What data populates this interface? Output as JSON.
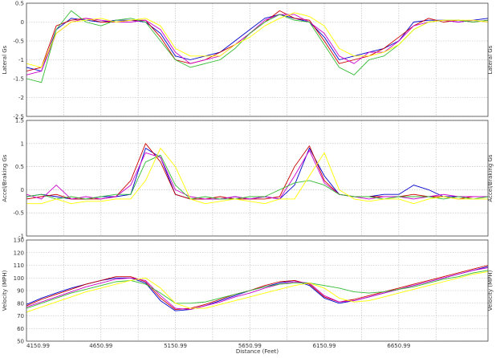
{
  "chart_data": {
    "type": "line",
    "xlabel": "Distance (Feet)",
    "x_ticks": [
      "4150.99",
      "4650.99",
      "5150.99",
      "5650.99",
      "6150.99",
      "6650.99"
    ],
    "xlim": [
      4150.99,
      7250
    ],
    "grid": true,
    "series_colors": [
      "#0000cc",
      "#cc0000",
      "#cc00cc",
      "#33bb33",
      "#ffff00"
    ],
    "x": [
      4150.99,
      4250.99,
      4350.99,
      4450.99,
      4550.99,
      4650.99,
      4750.99,
      4850.99,
      4950.99,
      5050.99,
      5150.99,
      5250.99,
      5350.99,
      5450.99,
      5550.99,
      5650.99,
      5750.99,
      5850.99,
      5950.99,
      6050.99,
      6150.99,
      6250.99,
      6350.99,
      6450.99,
      6550.99,
      6650.99,
      6750.99,
      6850.99,
      6950.99,
      7050.99,
      7150.99,
      7250.99
    ],
    "panels": [
      {
        "ylabel_left": "Lateral Gs",
        "ylabel_right": "Lateral Gs",
        "ylim": [
          -2.5,
          0.5
        ],
        "y_ticks": [
          "0.5",
          "0",
          "-0.5",
          "-1",
          "-1.5",
          "-2",
          "-2.5"
        ],
        "series": [
          {
            "values": [
              -1.2,
              -1.3,
              -0.2,
              0.1,
              0.05,
              0.0,
              0.05,
              0.05,
              0.0,
              -0.3,
              -0.9,
              -1.0,
              -0.9,
              -0.8,
              -0.5,
              -0.2,
              0.1,
              0.2,
              0.1,
              0.0,
              -0.4,
              -1.0,
              -0.9,
              -0.8,
              -0.7,
              -0.5,
              0.0,
              0.05,
              0.05,
              0.0,
              0.05,
              0.1
            ]
          },
          {
            "values": [
              -1.3,
              -1.2,
              -0.1,
              0.05,
              0.1,
              0.0,
              0.0,
              0.05,
              0.05,
              -0.4,
              -1.0,
              -1.1,
              -1.0,
              -0.8,
              -0.6,
              -0.3,
              0.0,
              0.3,
              0.1,
              0.05,
              -0.5,
              -1.1,
              -1.0,
              -0.9,
              -0.7,
              -0.4,
              -0.1,
              0.1,
              0.0,
              0.05,
              0.0,
              0.05
            ]
          },
          {
            "values": [
              -1.4,
              -1.3,
              -0.3,
              0.0,
              0.1,
              0.05,
              0.0,
              0.0,
              0.05,
              -0.2,
              -0.8,
              -1.1,
              -1.0,
              -0.9,
              -0.6,
              -0.3,
              0.05,
              0.2,
              0.2,
              0.0,
              -0.3,
              -0.9,
              -1.1,
              -0.8,
              -0.8,
              -0.5,
              -0.1,
              0.0,
              0.05,
              0.0,
              0.05,
              0.0
            ]
          },
          {
            "values": [
              -1.5,
              -1.6,
              -0.2,
              0.3,
              0.0,
              -0.1,
              0.05,
              0.1,
              0.0,
              -0.5,
              -1.0,
              -1.2,
              -1.1,
              -1.0,
              -0.7,
              -0.3,
              0.0,
              0.2,
              0.05,
              0.0,
              -0.6,
              -1.2,
              -1.4,
              -1.0,
              -0.9,
              -0.6,
              -0.2,
              0.0,
              0.05,
              0.05,
              0.0,
              0.05
            ]
          },
          {
            "values": [
              -1.1,
              -1.2,
              -0.3,
              0.0,
              0.05,
              0.1,
              0.0,
              0.05,
              0.1,
              -0.1,
              -0.7,
              -0.9,
              -0.9,
              -0.9,
              -0.6,
              -0.4,
              -0.1,
              0.1,
              0.25,
              0.15,
              -0.1,
              -0.7,
              -0.9,
              -0.9,
              -0.8,
              -0.6,
              -0.2,
              0.0,
              0.05,
              0.05,
              0.05,
              0.0
            ]
          }
        ]
      },
      {
        "ylabel_left": "Accel/Braking Gs",
        "ylabel_right": "Accel/Braking Gs",
        "ylim": [
          -1,
          1.5
        ],
        "y_ticks": [
          "1.5",
          "1",
          "0.5",
          "0",
          "-0.5",
          "-1"
        ],
        "series": [
          {
            "values": [
              -0.15,
              -0.1,
              -0.15,
              -0.2,
              -0.2,
              -0.15,
              -0.15,
              -0.1,
              0.9,
              0.7,
              -0.1,
              -0.2,
              -0.2,
              -0.2,
              -0.15,
              -0.2,
              -0.15,
              -0.2,
              0.1,
              0.9,
              0.3,
              -0.1,
              -0.15,
              -0.15,
              -0.1,
              -0.1,
              0.1,
              0.0,
              -0.15,
              -0.15,
              -0.15,
              -0.15
            ]
          },
          {
            "values": [
              -0.2,
              -0.15,
              -0.1,
              -0.2,
              -0.2,
              -0.2,
              -0.15,
              0.2,
              1.0,
              0.6,
              -0.1,
              -0.2,
              -0.2,
              -0.15,
              -0.2,
              -0.2,
              -0.2,
              -0.15,
              0.5,
              0.95,
              0.2,
              -0.1,
              -0.15,
              -0.15,
              -0.15,
              -0.15,
              -0.1,
              -0.15,
              -0.15,
              -0.2,
              -0.15,
              -0.15
            ]
          },
          {
            "values": [
              -0.1,
              -0.2,
              0.1,
              -0.2,
              -0.15,
              -0.2,
              -0.15,
              0.1,
              0.8,
              0.7,
              0.0,
              -0.15,
              -0.2,
              -0.2,
              -0.15,
              -0.2,
              -0.15,
              -0.2,
              0.3,
              0.85,
              0.15,
              -0.1,
              -0.15,
              -0.2,
              -0.15,
              -0.15,
              -0.2,
              -0.15,
              -0.1,
              -0.15,
              -0.15,
              -0.15
            ]
          },
          {
            "values": [
              -0.15,
              -0.1,
              -0.2,
              -0.15,
              -0.2,
              -0.15,
              -0.1,
              -0.1,
              0.6,
              0.75,
              0.1,
              -0.2,
              -0.15,
              -0.2,
              -0.2,
              -0.15,
              -0.15,
              0.0,
              0.15,
              0.2,
              0.1,
              -0.1,
              -0.15,
              -0.15,
              -0.2,
              -0.15,
              -0.15,
              -0.15,
              -0.2,
              -0.15,
              -0.2,
              -0.15
            ]
          },
          {
            "values": [
              -0.3,
              -0.3,
              -0.2,
              -0.3,
              -0.25,
              -0.25,
              -0.2,
              -0.2,
              0.2,
              0.9,
              0.5,
              -0.2,
              -0.3,
              -0.25,
              -0.2,
              -0.25,
              -0.3,
              -0.2,
              -0.2,
              0.3,
              0.8,
              0.0,
              -0.2,
              -0.25,
              -0.2,
              -0.2,
              -0.3,
              -0.2,
              -0.15,
              -0.2,
              -0.2,
              -0.2
            ]
          }
        ]
      },
      {
        "ylabel_left": "Velocity (MPH)",
        "ylabel_right": "Velocity (MPH)",
        "ylim": [
          50,
          130
        ],
        "y_ticks": [
          "130",
          "120",
          "110",
          "100",
          "90",
          "80",
          "70",
          "60",
          "50"
        ],
        "series": [
          {
            "values": [
              79,
              84,
              88,
              92,
              95,
              98,
              100,
              100,
              96,
              82,
              74,
              75,
              78,
              82,
              86,
              90,
              93,
              96,
              98,
              94,
              84,
              80,
              82,
              85,
              88,
              91,
              94,
              97,
              100,
              103,
              106,
              109
            ]
          },
          {
            "values": [
              78,
              83,
              87,
              91,
              95,
              98,
              101,
              101,
              97,
              84,
              75,
              76,
              79,
              83,
              87,
              90,
              94,
              97,
              98,
              95,
              85,
              81,
              83,
              86,
              89,
              92,
              95,
              98,
              101,
              104,
              107,
              110
            ]
          },
          {
            "values": [
              77,
              81,
              85,
              89,
              93,
              96,
              99,
              100,
              98,
              86,
              76,
              75,
              78,
              81,
              85,
              88,
              92,
              95,
              97,
              96,
              86,
              81,
              82,
              85,
              88,
              91,
              94,
              97,
              100,
              103,
              106,
              108
            ]
          },
          {
            "values": [
              76,
              80,
              84,
              88,
              91,
              94,
              97,
              98,
              95,
              88,
              80,
              80,
              81,
              84,
              87,
              90,
              93,
              95,
              96,
              96,
              94,
              92,
              89,
              88,
              89,
              91,
              93,
              96,
              99,
              101,
              104,
              106
            ]
          },
          {
            "values": [
              73,
              77,
              81,
              85,
              89,
              92,
              95,
              98,
              100,
              92,
              80,
              76,
              76,
              79,
              82,
              85,
              88,
              91,
              94,
              96,
              92,
              84,
              81,
              82,
              85,
              88,
              91,
              94,
              97,
              100,
              103,
              105
            ]
          }
        ]
      }
    ]
  }
}
